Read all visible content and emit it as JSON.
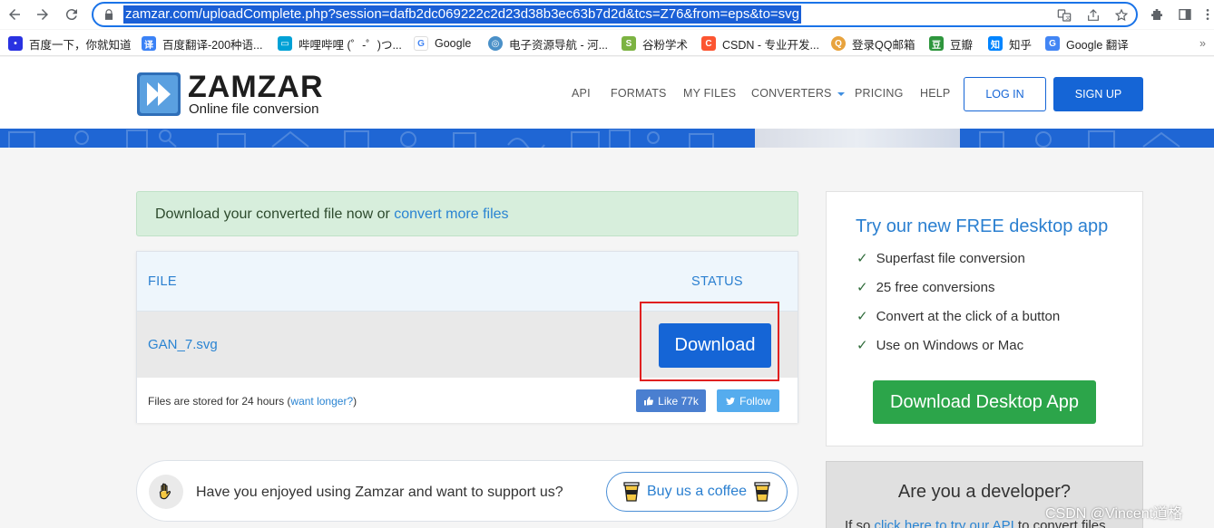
{
  "browser": {
    "url_display": "zamzar.com/uploadComplete.php?session=dafb2dc069222c2d23d38b3ec63b7d2d&tcs=Z76&from=eps&to=svg",
    "bookmarks": [
      {
        "label": "百度一下，你就知道",
        "icon_color": "#2932e1",
        "icon": "paw"
      },
      {
        "label": "百度翻译-200种语...",
        "icon_color": "#3b82f6",
        "icon": "译"
      },
      {
        "label": "哔哩哔哩 (゜-゜)つ...",
        "icon_color": "#00a1d6",
        "icon": "tv"
      },
      {
        "label": "Google",
        "icon_color": "#ffffff",
        "icon": "G"
      },
      {
        "label": "电子资源导航 - 河...",
        "icon_color": "#4a90c8",
        "icon": "globe"
      },
      {
        "label": "谷粉学术",
        "icon_color": "#7cb342",
        "icon": "S"
      },
      {
        "label": "CSDN - 专业开发...",
        "icon_color": "#fc5531",
        "icon": "C"
      },
      {
        "label": "登录QQ邮箱",
        "icon_color": "#e8a33d",
        "icon": "qq"
      },
      {
        "label": "豆瓣",
        "icon_color": "#2e963d",
        "icon": "豆"
      },
      {
        "label": "知乎",
        "icon_color": "#0084ff",
        "icon": "知"
      },
      {
        "label": "Google 翻译",
        "icon_color": "#4285f4",
        "icon": "G"
      }
    ]
  },
  "header": {
    "brand": "ZAMZAR",
    "tm": "™",
    "tagline": "Online file conversion",
    "nav": [
      "API",
      "FORMATS",
      "MY FILES",
      "CONVERTERS",
      "PRICING",
      "HELP"
    ],
    "login_label": "LOG IN",
    "signup_label": "SIGN UP"
  },
  "alert": {
    "text": "Download your converted file now or ",
    "link": "convert more files"
  },
  "files": {
    "col_file": "FILE",
    "col_status": "STATUS",
    "rows": [
      {
        "name": "GAN_7.svg",
        "action": "Download"
      }
    ],
    "storage_note": "Files are stored for 24 hours (",
    "storage_link": "want longer?",
    "storage_close": ")",
    "like_label": "Like 77k",
    "follow_label": "Follow"
  },
  "support": {
    "text": "Have you enjoyed using Zamzar and want to support us?",
    "button_label": "Buy us a coffee"
  },
  "desktop_app": {
    "title": "Try our new FREE desktop app",
    "features": [
      "Superfast file conversion",
      "25 free conversions",
      "Convert at the click of a button",
      "Use on Windows or Mac"
    ],
    "button_label": "Download Desktop App"
  },
  "developer": {
    "title": "Are you a developer?",
    "text_prefix": "If so ",
    "link": "click here to try our API",
    "text_suffix": " to convert files"
  },
  "watermark": "CSDN @Vincent道格",
  "colors": {
    "primary": "#1565d6",
    "link": "#2a84d2",
    "success_bg": "#d7eedc",
    "green_button": "#2ca54a",
    "highlight": "#e02020"
  }
}
